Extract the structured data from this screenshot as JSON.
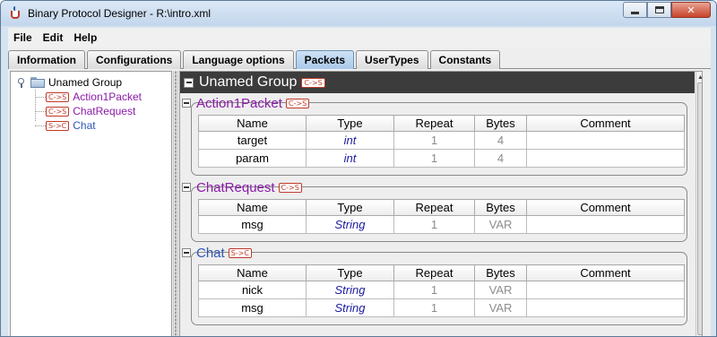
{
  "window": {
    "title": "Binary Protocol Designer - R:\\intro.xml"
  },
  "menu": [
    {
      "label": "File"
    },
    {
      "label": "Edit"
    },
    {
      "label": "Help"
    }
  ],
  "tabs": [
    {
      "label": "Information"
    },
    {
      "label": "Configurations"
    },
    {
      "label": "Language options"
    },
    {
      "label": "Packets",
      "active": true
    },
    {
      "label": "UserTypes"
    },
    {
      "label": "Constants"
    }
  ],
  "tree": {
    "root": "Unamed Group",
    "items": [
      {
        "label": "Action1Packet",
        "direction": "C->S"
      },
      {
        "label": "ChatRequest",
        "direction": "C->S"
      },
      {
        "label": "Chat",
        "direction": "S->C"
      }
    ]
  },
  "group": {
    "title": "Unamed Group",
    "direction": "C->S"
  },
  "columns": [
    "Name",
    "Type",
    "Repeat",
    "Bytes",
    "Comment"
  ],
  "packets": [
    {
      "name": "Action1Packet",
      "direction": "C->S",
      "color": "#8a1ba8",
      "rows": [
        {
          "name": "target",
          "type": "int",
          "repeat": "1",
          "bytes": "4",
          "comment": ""
        },
        {
          "name": "param",
          "type": "int",
          "repeat": "1",
          "bytes": "4",
          "comment": ""
        }
      ]
    },
    {
      "name": "ChatRequest",
      "direction": "C->S",
      "color": "#8a1ba8",
      "rows": [
        {
          "name": "msg",
          "type": "String",
          "repeat": "1",
          "bytes": "VAR",
          "comment": ""
        }
      ]
    },
    {
      "name": "Chat",
      "direction": "S->C",
      "color": "#2f56b6",
      "rows": [
        {
          "name": "nick",
          "type": "String",
          "repeat": "1",
          "bytes": "VAR",
          "comment": ""
        },
        {
          "name": "msg",
          "type": "String",
          "repeat": "1",
          "bytes": "VAR",
          "comment": ""
        }
      ]
    }
  ]
}
